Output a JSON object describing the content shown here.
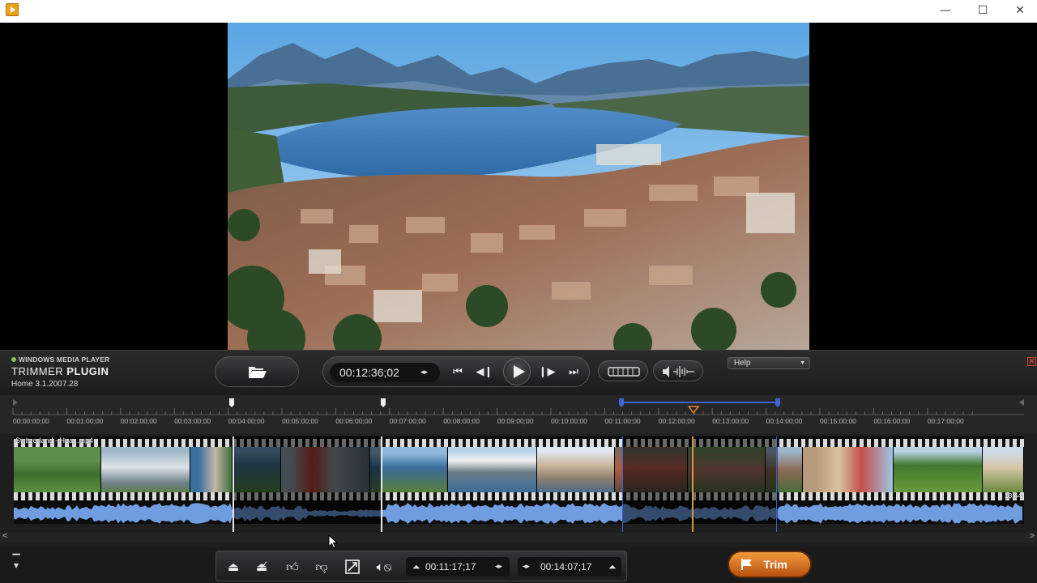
{
  "window": {
    "minimize_glyph": "—",
    "maximize_glyph": "☐",
    "close_glyph": "✕"
  },
  "plugin": {
    "brand_small": "WINDOWS MEDIA PLAYER",
    "brand_big_1": "TRIMMER ",
    "brand_big_2": "PLUGIN",
    "version": "Home 3.1.2007.28"
  },
  "transport": {
    "current_time": "00:12:36;02",
    "step_arrows": "◂▸",
    "help_label": "Help",
    "close_glyph": "✕"
  },
  "timeline": {
    "ruler_labels": [
      "00:00:00;00",
      "00:01:00;00",
      "00:02:00;00",
      "00:03:00;00",
      "00:04:00;00",
      "00:05:00;00",
      "00:06:00;00",
      "00:07:00;00",
      "00:08:00;00",
      "00:09:00;00",
      "00:10:00;00",
      "00:11:00;00",
      "00:12:00;00",
      "00:13:00;00",
      "00:14:00;00",
      "00:15:00;00",
      "00:16:00;00",
      "00:17:00;00"
    ],
    "clip_name": "Switzerland - Hea...mp4",
    "clip_duration": "18:44",
    "scroll_left_glyph": "<",
    "scroll_right_glyph": ">"
  },
  "toolbar": {
    "mark_in": "00:11:17;17",
    "mark_out": "00:14:07;17",
    "trim_label": "Trim",
    "step_arrows": "◂▸"
  },
  "colors": {
    "waveform": "#6f9de0",
    "accent_orange": "#e0852e",
    "selection_blue": "#3f63d0"
  },
  "icons": [
    "folder-icon",
    "skip-start-icon",
    "step-back-icon",
    "play-icon",
    "step-forward-icon",
    "skip-end-icon",
    "filmstrip-view-icon",
    "audio-wave-icon",
    "eject-icon",
    "clear-icon",
    "thumbs-up-icon",
    "thumbs-down-icon",
    "resize-icon",
    "mute-icon",
    "mark-in-icon",
    "mark-out-icon",
    "flag-icon",
    "collapse-icon"
  ]
}
